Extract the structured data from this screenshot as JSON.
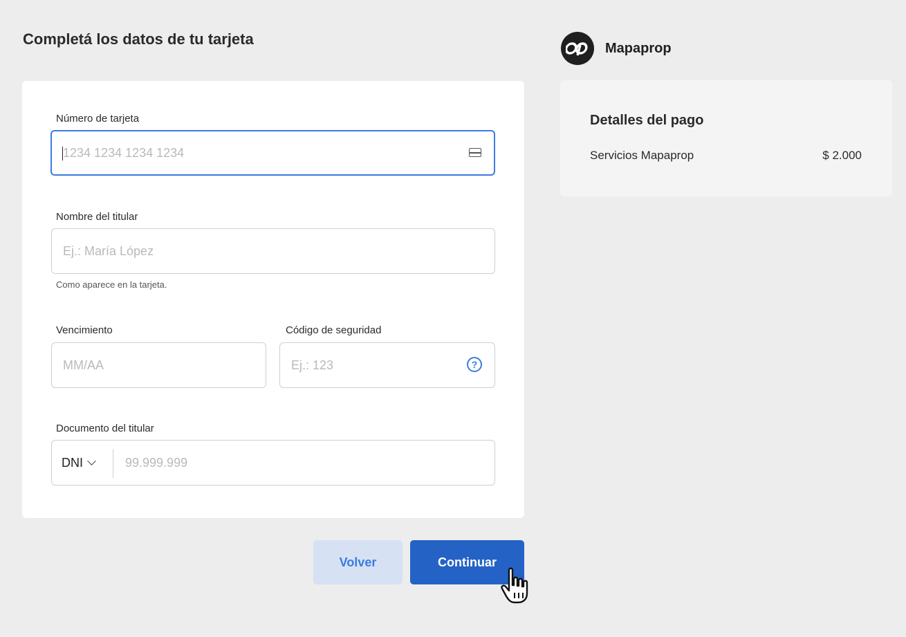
{
  "form": {
    "title": "Completá los datos de tu tarjeta",
    "card_number": {
      "label": "Número de tarjeta",
      "placeholder": "1234 1234 1234 1234",
      "value": ""
    },
    "holder_name": {
      "label": "Nombre del titular",
      "placeholder": "Ej.: María López",
      "value": "",
      "hint": "Como aparece en la tarjeta."
    },
    "expiry": {
      "label": "Vencimiento",
      "placeholder": "MM/AA",
      "value": ""
    },
    "security_code": {
      "label": "Código de seguridad",
      "placeholder": "Ej.: 123",
      "value": "",
      "help_glyph": "?"
    },
    "document": {
      "label": "Documento del titular",
      "type_selected": "DNI",
      "placeholder": "99.999.999",
      "value": ""
    }
  },
  "actions": {
    "back_label": "Volver",
    "continue_label": "Continuar"
  },
  "merchant": {
    "name": "Mapaprop",
    "logo_text": "op"
  },
  "summary": {
    "title": "Detalles del pago",
    "items": [
      {
        "label": "Servicios Mapaprop",
        "amount": "$ 2.000"
      }
    ]
  },
  "colors": {
    "accent": "#3a7be0",
    "primary_button": "#2462c6",
    "secondary_button": "#d6e2f3",
    "background": "#ededed"
  },
  "icons": {
    "card_field": "credit-card-icon",
    "cvv_help": "question-circle-icon",
    "doc_dropdown": "chevron-down-icon",
    "pointer": "hand-pointer-icon"
  }
}
